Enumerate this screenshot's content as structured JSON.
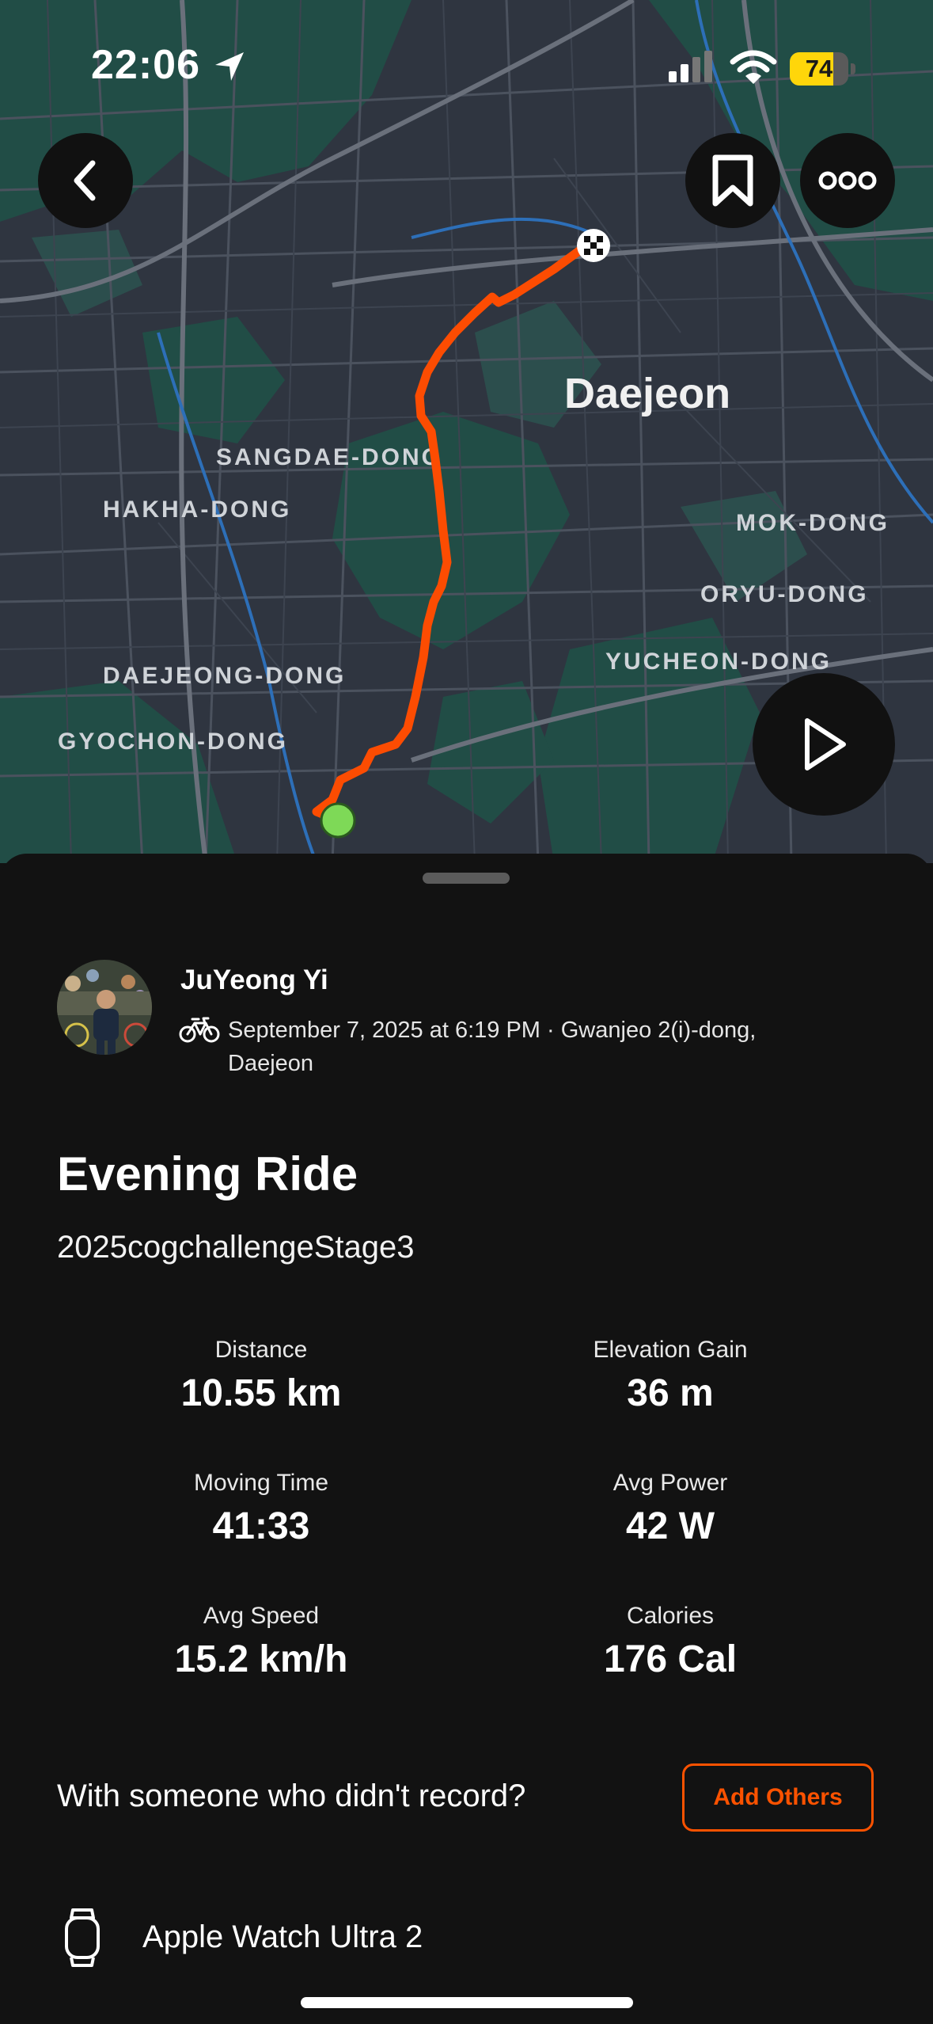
{
  "status_bar": {
    "time": "22:06",
    "battery": "74",
    "battery_level": 0.74
  },
  "map": {
    "labels": {
      "city": "Daejeon",
      "sangdae": "SANGDAE-DONG",
      "hakha": "HAKHA-DONG",
      "mok": "MOK-DONG",
      "oryu": "ORYU-DONG",
      "yucheon": "YUCHEON-DONG",
      "daejeong": "DAEJEONG-DONG",
      "gyochon": "GYOCHON-DONG"
    },
    "route_color": "#fc4c02",
    "start_color": "#7ed957"
  },
  "activity": {
    "athlete": "JuYeong Yi",
    "meta": "September 7, 2025 at 6:19 PM · Gwanjeo 2(i)-dong, Daejeon",
    "title": "Evening Ride",
    "description": "2025cogchallengeStage3"
  },
  "stats": [
    {
      "label": "Distance",
      "value": "10.55 km"
    },
    {
      "label": "Elevation Gain",
      "value": "36 m"
    },
    {
      "label": "Moving Time",
      "value": "41:33"
    },
    {
      "label": "Avg Power",
      "value": "42 W"
    },
    {
      "label": "Avg Speed",
      "value": "15.2 km/h"
    },
    {
      "label": "Calories",
      "value": "176 Cal"
    }
  ],
  "others": {
    "prompt": "With someone who didn't record?",
    "button": "Add Others"
  },
  "device": {
    "name": "Apple Watch Ultra 2",
    "icon": "watch-icon"
  },
  "colors": {
    "accent": "#fc5200",
    "background": "#121212"
  }
}
